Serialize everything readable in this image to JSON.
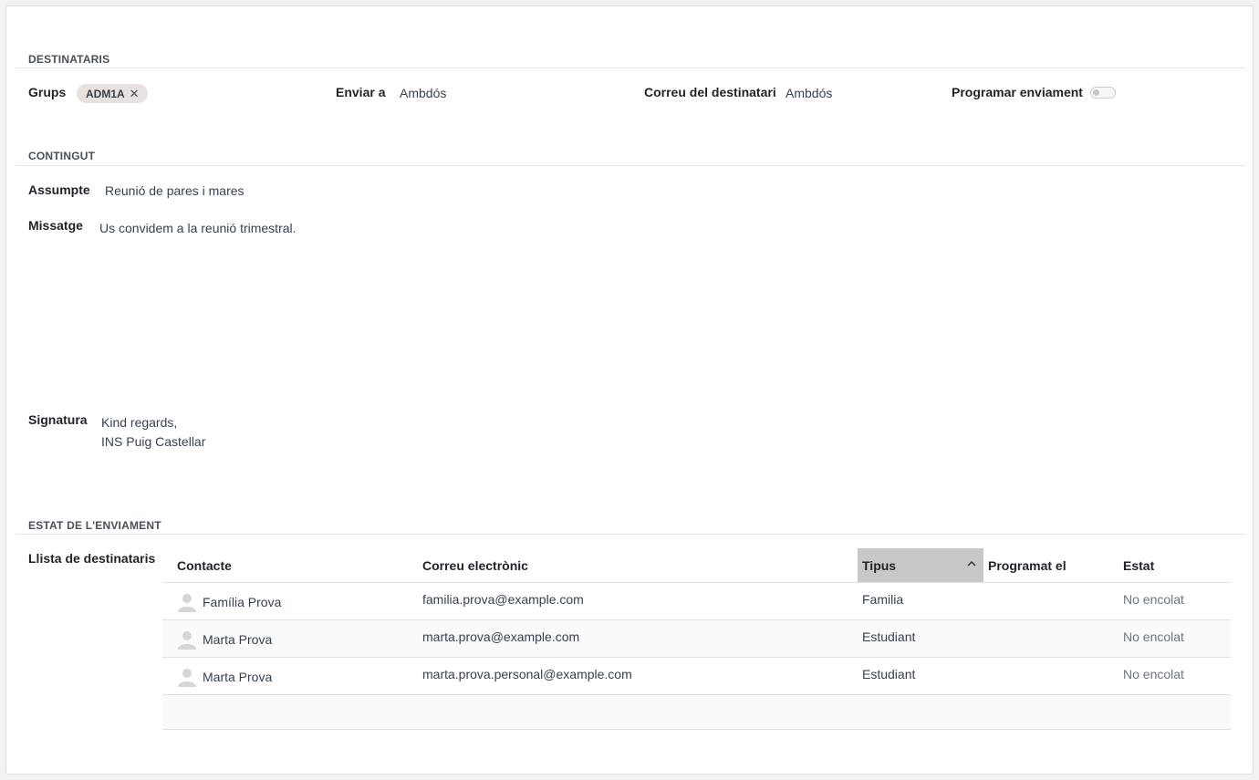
{
  "sections": {
    "recipients": "DESTINATARIS",
    "content": "CONTINGUT",
    "status": "ESTAT DE L'ENVIAMENT"
  },
  "recipients": {
    "groups_label": "Grups",
    "group_tag": "ADM1A",
    "send_to_label": "Enviar a",
    "send_to_value": "Ambdós",
    "recipient_email_label": "Correu del destinatari",
    "recipient_email_value": "Ambdós",
    "schedule_label": "Programar enviament",
    "schedule_enabled": false
  },
  "content": {
    "subject_label": "Assumpte",
    "subject_value": "Reunió de pares i mares",
    "message_label": "Missatge",
    "message_value": "Us convidem a la reunió trimestral.",
    "signature_label": "Signatura",
    "signature_line1": "Kind regards,",
    "signature_line2": "INS Puig Castellar"
  },
  "status": {
    "list_label": "Llista de destinataris",
    "columns": {
      "contact": "Contacte",
      "email": "Correu electrònic",
      "type": "Tipus",
      "scheduled": "Programat el",
      "state": "Estat"
    },
    "rows": [
      {
        "contact": "Família Prova",
        "email": "familia.prova@example.com",
        "type": "Familia",
        "scheduled": "",
        "state": "No encolat"
      },
      {
        "contact": "Marta Prova",
        "email": "marta.prova@example.com",
        "type": "Estudiant",
        "scheduled": "",
        "state": "No encolat"
      },
      {
        "contact": "Marta Prova",
        "email": "marta.prova.personal@example.com",
        "type": "Estudiant",
        "scheduled": "",
        "state": "No encolat"
      }
    ]
  },
  "icons": {
    "tag_remove": "close-icon",
    "sort": "chevron-up-icon",
    "avatar": "user-avatar-icon"
  }
}
